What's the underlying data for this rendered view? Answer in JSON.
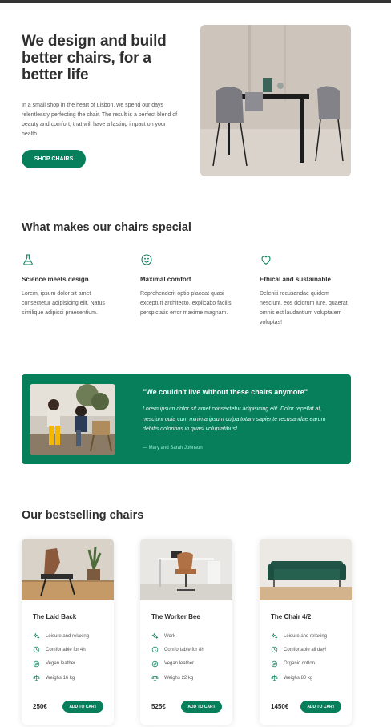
{
  "hero": {
    "title": "We design and build better chairs, for a better life",
    "text": "In a small shop in the heart of Lisbon, we spend our days relentlessly perfecting the chair. The result is a perfect blend of beauty and comfort, that will have a lasting impact on your health.",
    "cta_label": "SHOP CHAIRS"
  },
  "features": {
    "title": "What makes our chairs special",
    "items": [
      {
        "icon": "flask-icon",
        "title": "Science meets design",
        "text": "Lorem, ipsum dolor sit amet consectetur adipisicing elit. Natus similique adipisci praesentium."
      },
      {
        "icon": "smile-icon",
        "title": "Maximal comfort",
        "text": "Reprehenderit optio placeat quasi excepturi architecto, explicabo facilis perspiciatis error maxime magnam."
      },
      {
        "icon": "heart-icon",
        "title": "Ethical and sustainable",
        "text": "Deleniti recusandae quidem nesciunt, eos dolorum iure, quaerat omnis est laudantium voluptatem voluptas!"
      }
    ]
  },
  "testimonial": {
    "quote": "\"We couldn't live without these chairs anymore\"",
    "text": "Lorem ipsum dolor sit amet consectetur adipisicing elit. Dolor repellat at, nesciunt quia cum minima ipsum culpa totam sapiente recusandae earum debitis doloribus in quasi voluptatibus!",
    "author": "— Mary and Sarah Johnson"
  },
  "products": {
    "title": "Our bestselling chairs",
    "cart_label": "ADD TO CART",
    "items": [
      {
        "name": "The Laid Back",
        "attributes": [
          "Leisure and relaxing",
          "Comfortable for 4h",
          "Vegan leather",
          "Weighs 16 kg"
        ],
        "price": "250€"
      },
      {
        "name": "The Worker Bee",
        "attributes": [
          "Work",
          "Comfortable for 8h",
          "Vegan leather",
          "Weighs 22 kg"
        ],
        "price": "525€"
      },
      {
        "name": "The Chair 4/2",
        "attributes": [
          "Leisure and relaxing",
          "Comfortable all day!",
          "Organic cotton",
          "Weighs 80 kg"
        ],
        "price": "1450€"
      }
    ]
  },
  "colors": {
    "accent": "#087f5b",
    "accent_light": "#96f2d7",
    "text": "#2f2f2f"
  }
}
